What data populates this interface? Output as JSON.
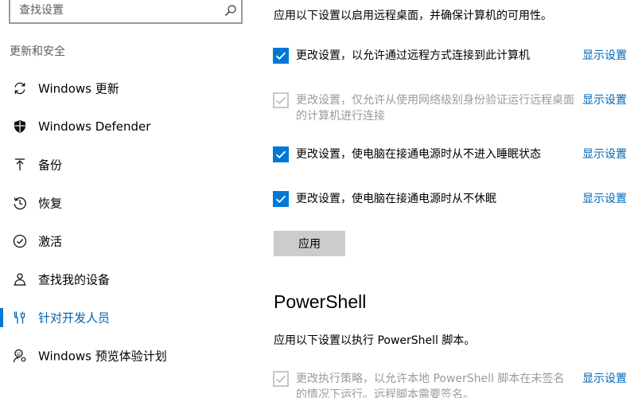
{
  "sidebar": {
    "search_placeholder": "查找设置",
    "section_title": "更新和安全",
    "items": [
      {
        "label": "Windows 更新",
        "icon": "refresh-icon"
      },
      {
        "label": "Windows Defender",
        "icon": "shield-icon"
      },
      {
        "label": "备份",
        "icon": "upload-arrow-icon"
      },
      {
        "label": "恢复",
        "icon": "restore-history-icon"
      },
      {
        "label": "激活",
        "icon": "check-circle-icon"
      },
      {
        "label": "查找我的设备",
        "icon": "person-location-icon"
      },
      {
        "label": "针对开发人员",
        "icon": "developer-tools-icon",
        "selected": true
      },
      {
        "label": "Windows 预览体验计划",
        "icon": "smiley-person-icon"
      }
    ]
  },
  "main": {
    "remote_desktop_intro": "应用以下设置以启用远程桌面，并确保计算机的可用性。",
    "settings": [
      {
        "label": "更改设置，以允许通过远程方式连接到此计算机",
        "link": "显示设置",
        "checked": true,
        "disabled": false
      },
      {
        "label": "更改设置，仅允许从使用网络级别身份验证运行远程桌面的计算机进行连接",
        "link": "显示设置",
        "checked": true,
        "disabled": true
      },
      {
        "label": "更改设置，使电脑在接通电源时从不进入睡眠状态",
        "link": "显示设置",
        "checked": true,
        "disabled": false
      },
      {
        "label": "更改设置，使电脑在接通电源时从不休眠",
        "link": "显示设置",
        "checked": true,
        "disabled": false
      }
    ],
    "apply_label": "应用",
    "powershell": {
      "heading": "PowerShell",
      "intro": "应用以下设置以执行 PowerShell 脚本。",
      "setting": {
        "label": "更改执行策略，以允许本地 PowerShell 脚本在未签名的情况下运行。远程脚本需要签名。",
        "link": "显示设置",
        "checked": true,
        "disabled": true
      }
    }
  },
  "colors": {
    "accent": "#0078d7",
    "link": "#0066b4",
    "disabled_text": "#9b9b9b",
    "button_bg": "#cccccc"
  }
}
